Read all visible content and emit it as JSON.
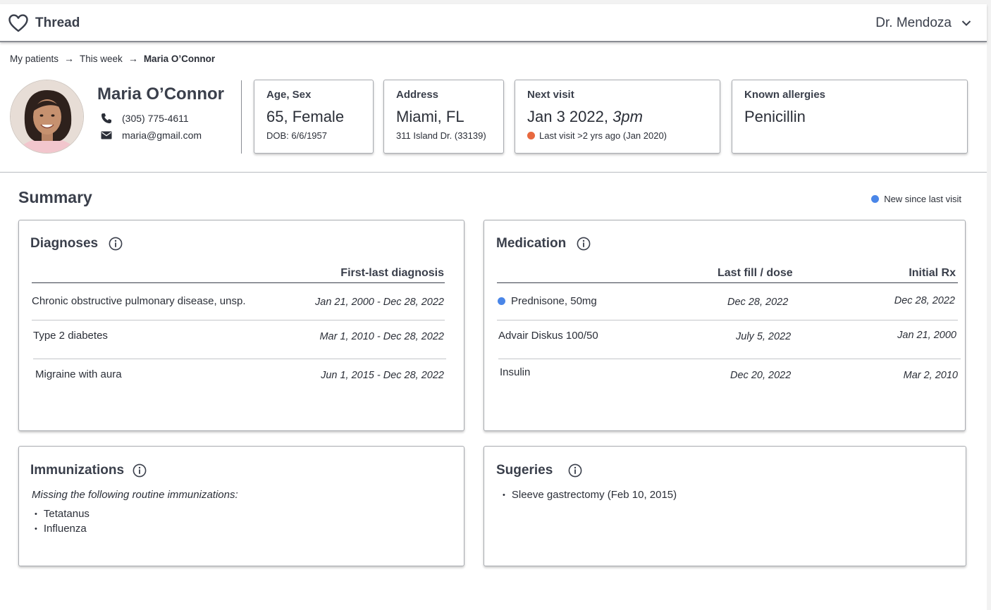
{
  "app": {
    "name": "Thread",
    "logo_icon": "heart-icon"
  },
  "user": {
    "name": "Dr. Mendoza",
    "menu_icon": "chevron-down-icon"
  },
  "breadcrumb": [
    "My patients",
    "This week",
    "Maria O’Connor"
  ],
  "patient": {
    "name": "Maria O’Connor",
    "phone": "(305) 775-4611",
    "email": "maria@gmail.com"
  },
  "cards": {
    "age": {
      "label": "Age, Sex",
      "value": "65, Female",
      "sub": "DOB: 6/6/1957"
    },
    "address": {
      "label": "Address",
      "value": "Miami, FL",
      "sub": "311 Island Dr. (33139)"
    },
    "next_visit": {
      "label": "Next visit",
      "date": "Jan 3 2022,",
      "time": "3pm",
      "sub": "Last visit >2 yrs ago (Jan 2020)",
      "alert_color": "#e8693f"
    },
    "allergies": {
      "label": "Known allergies",
      "value": "Penicillin"
    }
  },
  "summary": {
    "title": "Summary",
    "legend": "New since last visit",
    "new_color": "#4a86e8"
  },
  "diagnoses": {
    "title": "Diagnoses",
    "col": "First-last diagnosis",
    "rows": [
      {
        "name": "Chronic obstructive pulmonary disease, unsp.",
        "range": "Jan 21, 2000 - Dec 28, 2022"
      },
      {
        "name": "Type 2 diabetes",
        "range": "Mar 1, 2010 - Dec 28, 2022"
      },
      {
        "name": "Migraine with aura",
        "range": "Jun 1, 2015 - Dec 28, 2022"
      }
    ]
  },
  "medication": {
    "title": "Medication",
    "col_last": "Last fill / dose",
    "col_initial": "Initial Rx",
    "rows": [
      {
        "name": "Prednisone, 50mg",
        "last": "Dec 28, 2022",
        "initial": "Dec 28, 2022",
        "is_new": true
      },
      {
        "name": "Advair Diskus 100/50",
        "last": "July 5, 2022",
        "initial": "Jan 21, 2000",
        "is_new": false
      },
      {
        "name": "Insulin",
        "last": "Dec 20, 2022",
        "initial": "Mar 2, 2010",
        "is_new": false
      }
    ]
  },
  "immunizations": {
    "title": "Immunizations",
    "note": "Missing the following routine immunizations:",
    "items": [
      "Tetatanus",
      "Influenza"
    ]
  },
  "surgeries": {
    "title": "Sugeries",
    "items": [
      "Sleeve gastrectomy (Feb 10, 2015)"
    ]
  }
}
